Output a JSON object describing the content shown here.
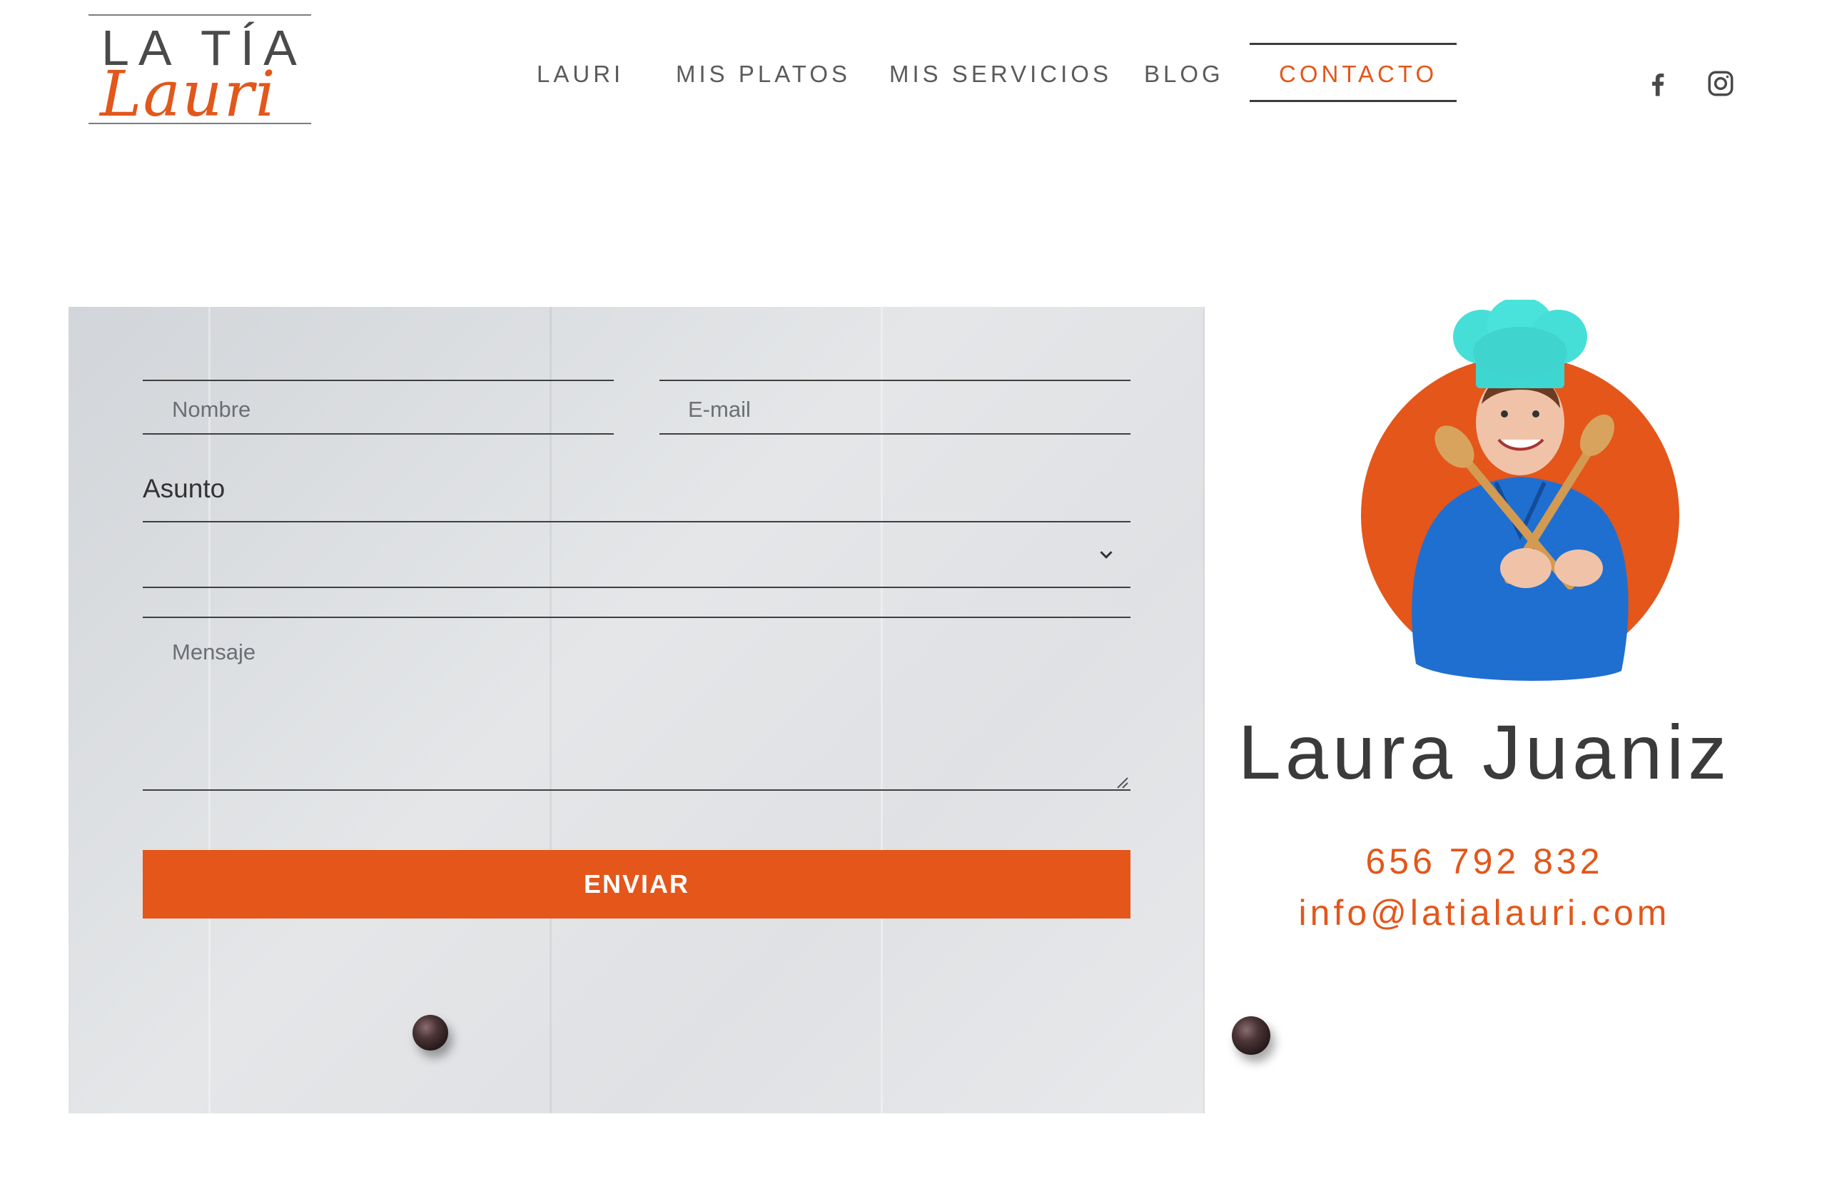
{
  "logo": {
    "line1": "LA TÍA",
    "line2": "Lauri"
  },
  "nav": {
    "items": [
      "LAURI",
      "MIS PLATOS",
      "MIS SERVICIOS",
      "BLOG",
      "CONTACTO"
    ],
    "active": "CONTACTO"
  },
  "social": [
    "facebook-icon",
    "instagram-icon"
  ],
  "form": {
    "name_placeholder": "Nombre",
    "email_placeholder": "E-mail",
    "subject_label": "Asunto",
    "subject_value": "",
    "message_placeholder": "Mensaje",
    "submit_label": "ENVIAR"
  },
  "contact": {
    "name": "Laura Juaniz",
    "phone": "656 792 832",
    "email": "info@latialauri.com"
  },
  "colors": {
    "accent": "#e4561a",
    "text": "#333333",
    "nav_text": "#5b5b5b"
  }
}
